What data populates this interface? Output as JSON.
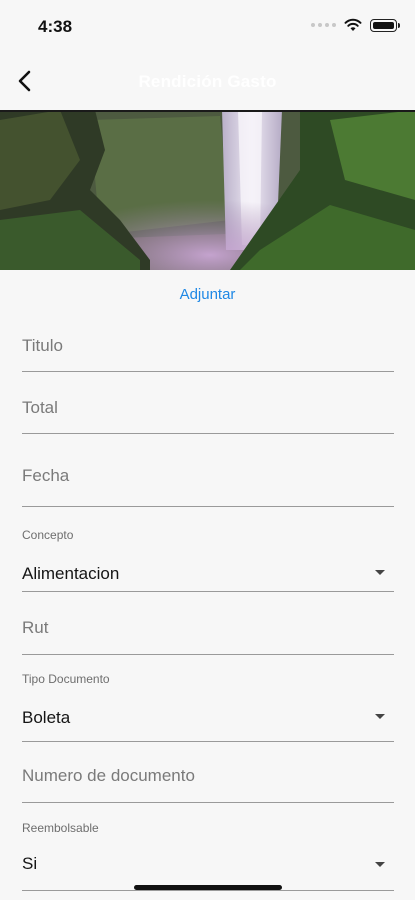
{
  "status_bar": {
    "time": "4:38"
  },
  "nav": {
    "title": "Rendición Gasto"
  },
  "attach_label": "Adjuntar",
  "fields": {
    "titulo": {
      "placeholder": "Titulo"
    },
    "total": {
      "placeholder": "Total"
    },
    "fecha": {
      "placeholder": "Fecha"
    },
    "concepto": {
      "label": "Concepto",
      "value": "Alimentacion"
    },
    "rut": {
      "placeholder": "Rut"
    },
    "tipo_documento": {
      "label": "Tipo Documento",
      "value": "Boleta"
    },
    "numero_documento": {
      "placeholder": "Numero de documento"
    },
    "reembolsable": {
      "label": "Reembolsable",
      "value": "Si"
    }
  },
  "icons": {
    "back": "chevron-left-icon",
    "dropdown": "caret-down-icon",
    "wifi": "wifi-icon",
    "battery": "battery-icon",
    "signal": "signal-icon"
  },
  "colors": {
    "accent": "#1e88e5",
    "background": "#f7f7f7"
  }
}
